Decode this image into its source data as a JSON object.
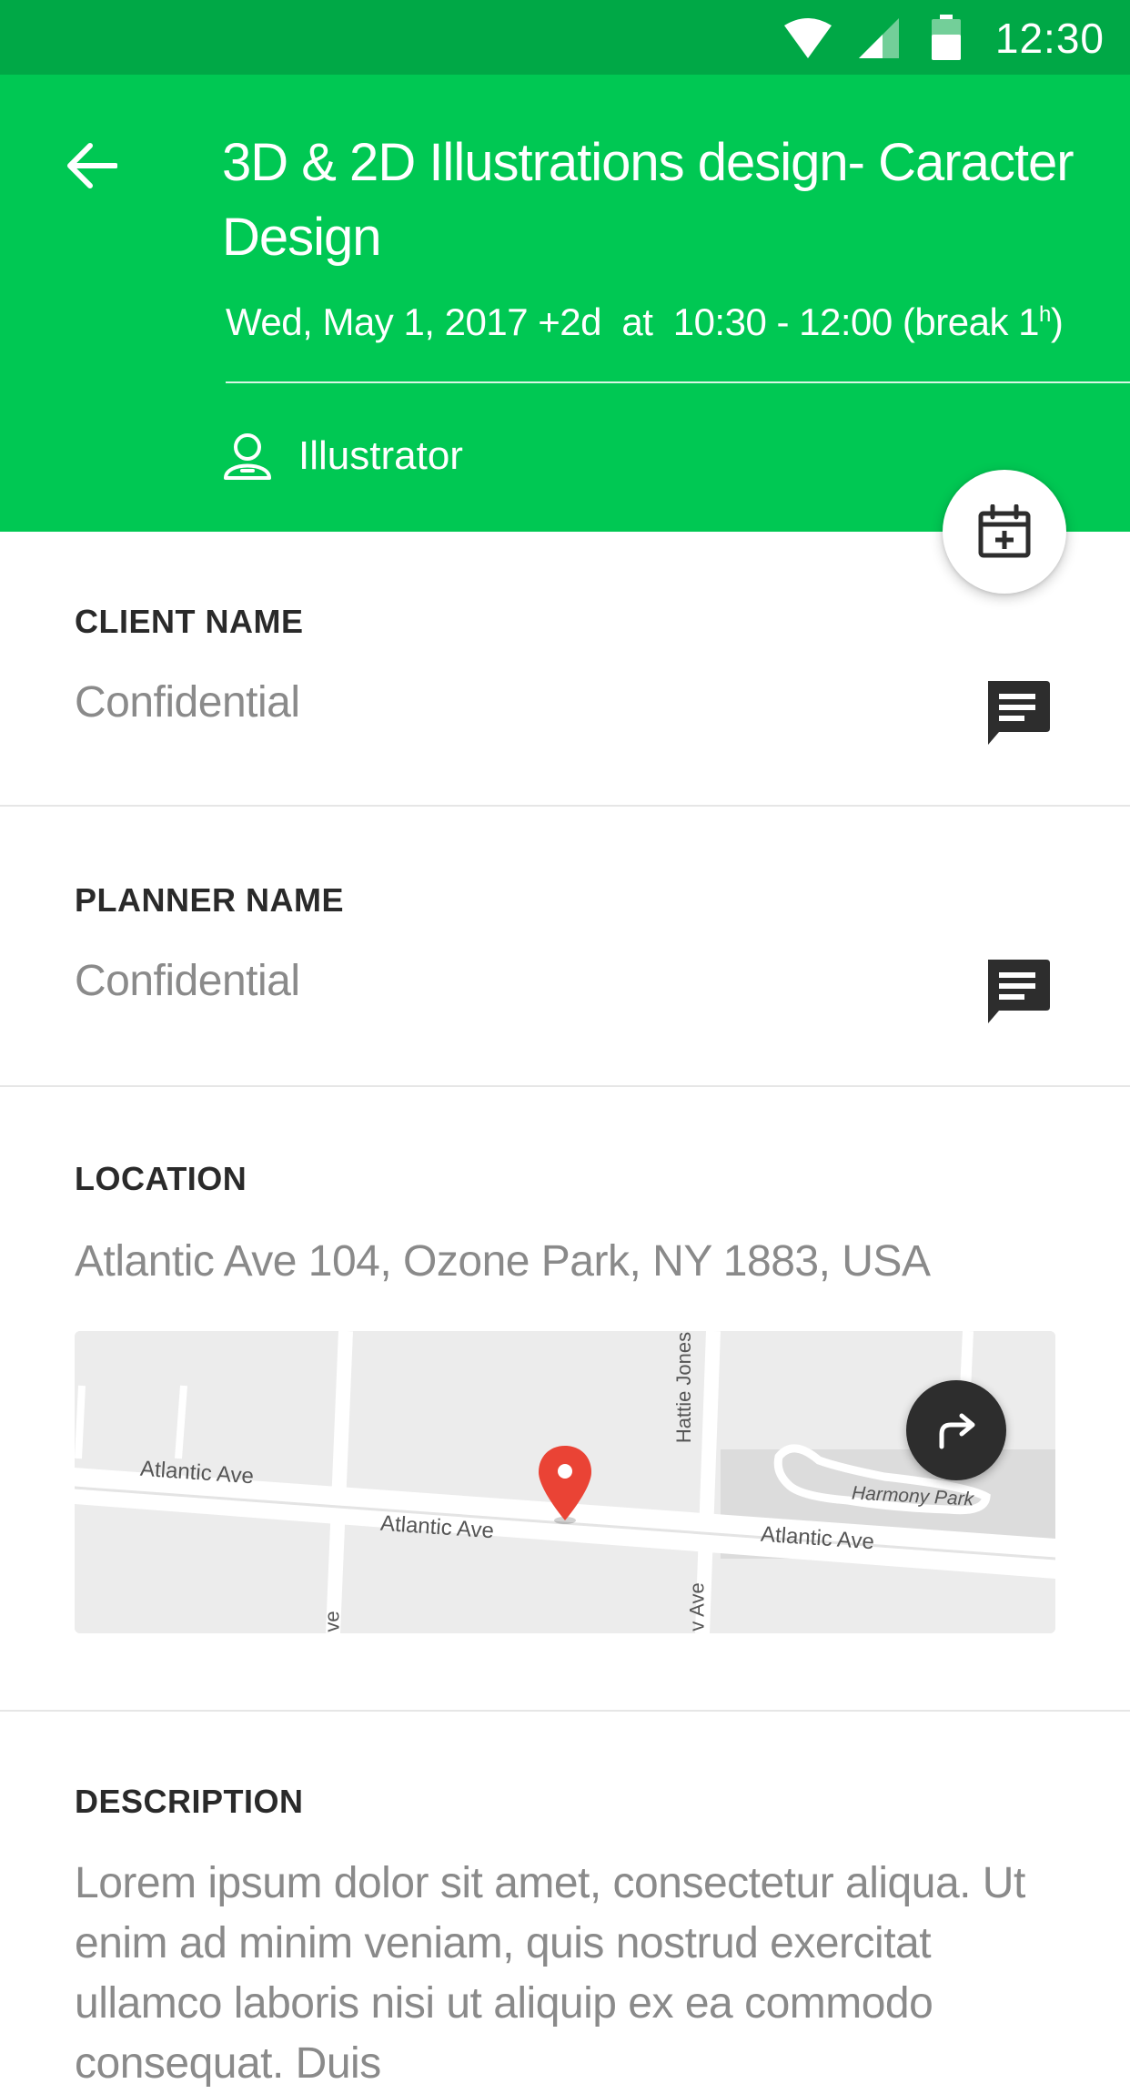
{
  "status_bar": {
    "time": "12:30",
    "icons": [
      "wifi-icon",
      "cell-signal-icon",
      "battery-icon"
    ]
  },
  "header": {
    "title": "3D & 2D Illustrations design- Caracter Design",
    "date": "Wed, May 1, 2017 +2d",
    "at": "at",
    "time_range": "10:30 - 12:00 (break 1",
    "break_unit": "h",
    "break_close": ")",
    "role": "Illustrator",
    "add_calendar_icon": "calendar-plus-icon",
    "back_icon": "arrow-left-icon"
  },
  "client": {
    "label": "CLIENT NAME",
    "value": "Confidential",
    "action_icon": "message-icon"
  },
  "planner": {
    "label": "PLANNER NAME",
    "value": "Confidential",
    "action_icon": "message-icon"
  },
  "location": {
    "label": "LOCATION",
    "address": "Atlantic Ave 104, Ozone Park, NY 1883, USA",
    "map": {
      "streets": [
        "Atlantic Ave",
        "Atlantic Ave",
        "Atlantic Ave",
        "Hattie Jones C",
        "ve",
        "v Ave"
      ],
      "park": "Harmony Park",
      "marker_icon": "map-pin-icon",
      "directions_icon": "directions-icon"
    }
  },
  "description": {
    "label": "DESCRIPTION",
    "text": "Lorem ipsum dolor sit amet, consectetur  aliqua. Ut enim ad minim veniam, quis nostrud exercitat ullamco laboris nisi ut aliquip ex ea commodo consequat. Duis"
  },
  "colors": {
    "primary": "#00c853",
    "status_bar": "#00a846",
    "dark_action": "#2d2d2d",
    "marker": "#ea4335"
  }
}
